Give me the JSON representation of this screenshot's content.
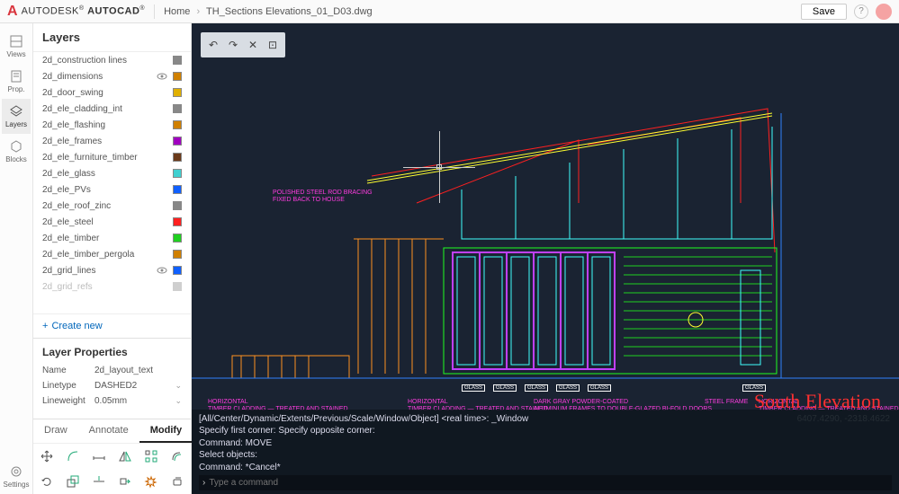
{
  "brand": {
    "company": "AUTODESK",
    "product": "AUTOCAD"
  },
  "breadcrumb": {
    "home": "Home",
    "file": "TH_Sections Elevations_01_D03.dwg"
  },
  "header": {
    "save": "Save",
    "help": "?"
  },
  "rail": {
    "views": "Views",
    "prop": "Prop.",
    "layers": "Layers",
    "blocks": "Blocks",
    "settings": "Settings"
  },
  "panel": {
    "title": "Layers"
  },
  "layers": [
    {
      "name": "2d_construction lines",
      "color": "#888888",
      "vis": false
    },
    {
      "name": "2d_dimensions",
      "color": "#d08000",
      "vis": true
    },
    {
      "name": "2d_door_swing",
      "color": "#e0b000",
      "vis": false
    },
    {
      "name": "2d_ele_cladding_int",
      "color": "#888888",
      "vis": false
    },
    {
      "name": "2d_ele_flashing",
      "color": "#d08000",
      "vis": false
    },
    {
      "name": "2d_ele_frames",
      "color": "#a000c0",
      "vis": false
    },
    {
      "name": "2d_ele_furniture_timber",
      "color": "#6b3a1a",
      "vis": false
    },
    {
      "name": "2d_ele_glass",
      "color": "#40d0d0",
      "vis": false
    },
    {
      "name": "2d_ele_PVs",
      "color": "#1060ff",
      "vis": false
    },
    {
      "name": "2d_ele_roof_zinc",
      "color": "#888888",
      "vis": false
    },
    {
      "name": "2d_ele_steel",
      "color": "#ff2020",
      "vis": false
    },
    {
      "name": "2d_ele_timber",
      "color": "#20d020",
      "vis": false
    },
    {
      "name": "2d_ele_timber_pergola",
      "color": "#d08000",
      "vis": false
    },
    {
      "name": "2d_grid_lines",
      "color": "#1060ff",
      "vis": true
    },
    {
      "name": "2d_grid_refs",
      "color": "#888888",
      "vis": false
    }
  ],
  "create_new": "Create new",
  "props": {
    "title": "Layer Properties",
    "name_label": "Name",
    "name_value": "2d_layout_text",
    "linetype_label": "Linetype",
    "linetype_value": "DASHED2",
    "lineweight_label": "Lineweight",
    "lineweight_value": "0.05mm"
  },
  "tabs": {
    "draw": "Draw",
    "annotate": "Annotate",
    "modify": "Modify"
  },
  "canvas": {
    "title": "South Elevation",
    "coords": "6407.4290, -2318.4622",
    "anno1a": "POLISHED STEEL ROD BRACING",
    "anno1b": "FIXED BACK TO HOUSE",
    "anno2": "HORIZONTAL",
    "anno2b": "TIMBER CLADDING — TREATED AND STAINED",
    "anno3": "DARK GRAY POWDER-COATED",
    "anno3b": "ALUMINUM FRAMES TO DOUBLE-GLAZED BI-FOLD DOORS",
    "anno4": "STEEL FRAME",
    "glass": "GLASS"
  },
  "cmd": {
    "l1": "[All/Center/Dynamic/Extents/Previous/Scale/Window/Object] <real time>: _Window",
    "l2": "Specify first corner: Specify opposite corner:",
    "l3": "Command: MOVE",
    "l4": "Select objects:",
    "l5": "Command: *Cancel*",
    "placeholder": "Type a command"
  }
}
